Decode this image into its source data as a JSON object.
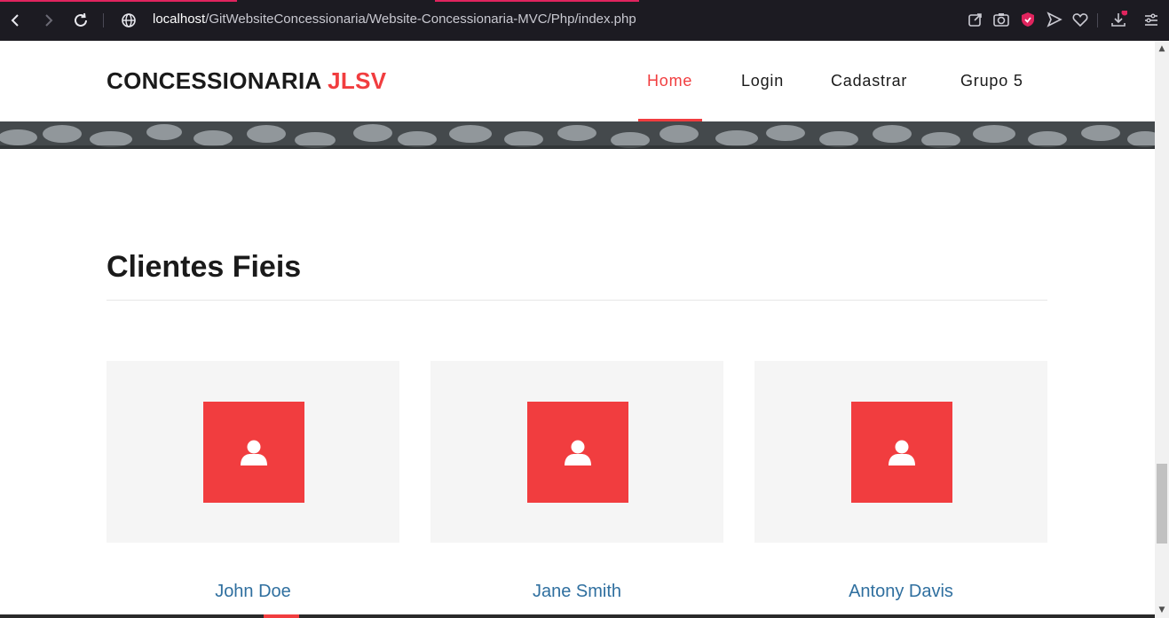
{
  "browser": {
    "url_host": "localhost",
    "url_path": "/GitWebsiteConcessionaria/Website-Concessionaria-MVC/Php/index.php",
    "icons": [
      "back-icon",
      "forward-icon",
      "reload-icon",
      "globe-icon",
      "share-icon",
      "camera-icon",
      "shield-icon",
      "send-icon",
      "heart-icon",
      "download-icon",
      "settings-icon"
    ]
  },
  "header": {
    "brand_main": "CONCESSIONARIA",
    "brand_accent": "JLSV",
    "nav": [
      {
        "label": "Home",
        "active": true
      },
      {
        "label": "Login",
        "active": false
      },
      {
        "label": "Cadastrar",
        "active": false
      },
      {
        "label": "Grupo 5",
        "active": false
      }
    ]
  },
  "section": {
    "title": "Clientes Fieis"
  },
  "clients": [
    {
      "name": "John Doe",
      "icon": "user-icon"
    },
    {
      "name": "Jane Smith",
      "icon": "user-icon"
    },
    {
      "name": "Antony Davis",
      "icon": "user-icon"
    }
  ],
  "colors": {
    "accent": "#f13d3f",
    "client_name": "#2f6f9f",
    "card_bg": "#f5f5f5",
    "browser_bg": "#1c1b22"
  }
}
